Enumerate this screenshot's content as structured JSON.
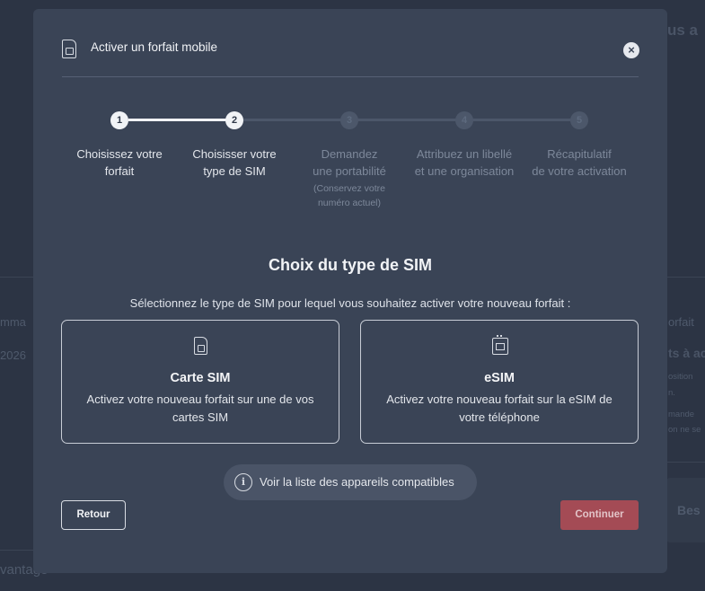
{
  "background": {
    "right_heading": "us a",
    "left_label": "mma",
    "left_year": "2026",
    "right_label": "orfait",
    "right_bold": "ts à ac",
    "right_line1": "osition",
    "right_line2": "n.",
    "right_line3": "mande",
    "right_line4": "on ne se",
    "bottom_left": "vantage",
    "right_button": "Bes"
  },
  "modal": {
    "title": "Activer un forfait mobile",
    "close_glyph": "×",
    "steps": [
      {
        "number": "1",
        "label_line1": "Choisissez votre",
        "label_line2": "forfait",
        "note": "",
        "state": "done"
      },
      {
        "number": "2",
        "label_line1": "Choisisser votre",
        "label_line2": "type de SIM",
        "note": "",
        "state": "done"
      },
      {
        "number": "3",
        "label_line1": "Demandez",
        "label_line2": "une portabilité",
        "note": "(Conservez votre numéro actuel)",
        "state": "todo"
      },
      {
        "number": "4",
        "label_line1": "Attribuez un libellé",
        "label_line2": "et une organisation",
        "note": "",
        "state": "todo"
      },
      {
        "number": "5",
        "label_line1": "Récapitulatif",
        "label_line2": "de votre activation",
        "note": "",
        "state": "todo"
      }
    ],
    "section_title": "Choix du type de SIM",
    "section_subtitle": "Sélectionnez le type de SIM pour lequel vous souhaitez activer votre nouveau forfait :",
    "options": [
      {
        "icon": "sim-card-icon",
        "title": "Carte SIM",
        "description": "Activez votre nouveau forfait sur une de vos cartes SIM"
      },
      {
        "icon": "esim-icon",
        "title": "eSIM",
        "description": "Activez votre nouveau forfait sur la eSIM de votre téléphone"
      }
    ],
    "compat_link": "Voir la liste des appareils compatibles",
    "info_glyph": "i",
    "back_button": "Retour",
    "continue_button": "Continuer"
  },
  "colors": {
    "page_bg": "#2c3444",
    "modal_bg": "#3a4456",
    "step_done": "#f1f3f6",
    "step_todo": "#4c576a",
    "continue_bg": "#a44b55"
  }
}
